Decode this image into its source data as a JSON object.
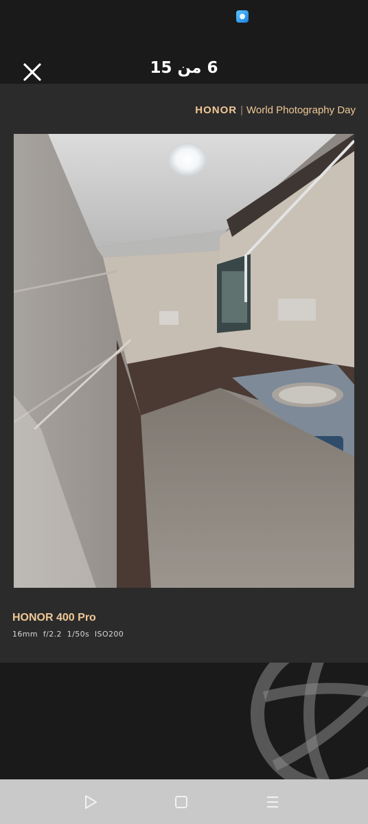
{
  "header": {
    "title": "6 من 15",
    "close_icon": "close-icon"
  },
  "status_bar": {
    "app_icon": "browser-app-icon"
  },
  "watermark": {
    "brand": "HONOR",
    "separator": "|",
    "tagline": "World Photography Day"
  },
  "photo_info": {
    "model": "HONOR 400 Pro",
    "exif": "16mm  f/2.2  1/50s  ISO200"
  },
  "overlay": {
    "icon": "globe-icon"
  },
  "nav": {
    "back_icon": "back-triangle-icon",
    "home_icon": "home-square-icon",
    "recents_icon": "recents-menu-icon"
  },
  "colors": {
    "accent": "#f0c896",
    "card_bg": "#2b2b2b",
    "screen_bg": "#1a1a1a",
    "nav_bg": "#c9c9c9"
  }
}
